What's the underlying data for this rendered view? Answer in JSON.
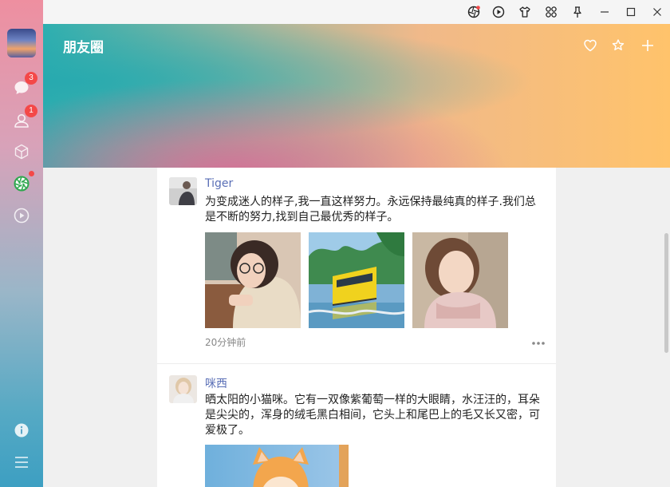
{
  "sidebar": {
    "chat_badge": "3",
    "contacts_badge": "1"
  },
  "header": {
    "title": "朋友圈"
  },
  "posts": [
    {
      "name": "Tiger",
      "text": "为变成迷人的样子,我一直这样努力。永远保持最纯真的样子.我们总是不断的努力,找到自己最优秀的样子。",
      "time": "20分钟前"
    },
    {
      "name": "咪西",
      "text": "晒太阳的小猫咪。它有一双像紫葡萄一样的大眼睛，水汪汪的，耳朵是尖尖的，浑身的绒毛黑白相间，它头上和尾巴上的毛又长又密，可爱极了。"
    }
  ],
  "colors": {
    "name_link": "#5a6fb6",
    "badge": "#f44848",
    "moments_icon": "#2fa84f"
  }
}
